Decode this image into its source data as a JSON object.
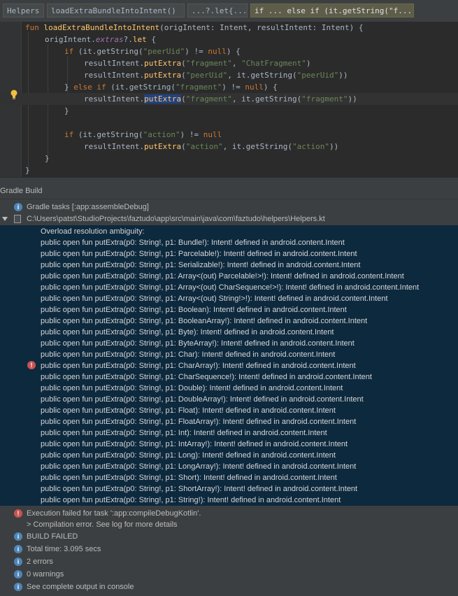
{
  "breadcrumbs": [
    "Helpers",
    "loadExtraBundleIntoIntent()",
    "...?.let{...}",
    "if ... else if (it.getString(\"f..."
  ],
  "code": {
    "l1": {
      "fun_kw": "fun ",
      "fn_name": "loadExtraBundleIntoIntent",
      "rest": "(origIntent: Intent, resultIntent: Intent) {"
    },
    "l2": {
      "a": "origIntent.",
      "extras": "extras",
      "b": "?.",
      "let": "let",
      "c": " {"
    },
    "l3": {
      "if": "if",
      "a": " (it.getString(",
      "s": "\"peerUid\"",
      "b": ") != ",
      "null": "null",
      "c": ") {"
    },
    "l4": {
      "a": "resultIntent.",
      "m": "putExtra",
      "b": "(",
      "s1": "\"fragment\"",
      "c": ", ",
      "s2": "\"ChatFragment\"",
      "d": ")"
    },
    "l5": {
      "a": "resultIntent.",
      "m": "putExtra",
      "b": "(",
      "s1": "\"peerUid\"",
      "c": ", it.getString(",
      "s2": "\"peerUid\"",
      "d": "))"
    },
    "l6": {
      "a": "} ",
      "else": "else",
      "sp": " ",
      "if": "if",
      "b": " (it.getString(",
      "s": "\"fragment\"",
      "c": ") != ",
      "null": "null",
      "d": ") {"
    },
    "l7": {
      "a": "resultIntent.",
      "m": "putExtra",
      "b": "(",
      "s1": "\"fragment\"",
      "c": ", it.getString(",
      "s2": "\"fragment\"",
      "d": "))"
    },
    "l8": "}",
    "l9": {
      "if": "if",
      "a": " (it.getString(",
      "s": "\"action\"",
      "b": ") != ",
      "null": "null"
    },
    "l10": {
      "a": "resultIntent.",
      "m": "putExtra",
      "b": "(",
      "s1": "\"action\"",
      "c": ", it.getString(",
      "s2": "\"action\"",
      "d": "))"
    },
    "l11": "}",
    "l12": "}"
  },
  "panel_title": "Gradle Build",
  "tree": {
    "gradle_tasks": "Gradle tasks [:app:assembleDebug]",
    "file_path": "C:\\Users\\patst\\StudioProjects\\faztudo\\app\\src\\main\\java\\com\\faztudo\\helpers\\Helpers.kt"
  },
  "error_lines": [
    "Overload resolution ambiguity:",
    "public open fun putExtra(p0: String!, p1: Bundle!): Intent! defined in android.content.Intent",
    "public open fun putExtra(p0: String!, p1: Parcelable!): Intent! defined in android.content.Intent",
    "public open fun putExtra(p0: String!, p1: Serializable!): Intent! defined in android.content.Intent",
    "public open fun putExtra(p0: String!, p1: Array<(out) Parcelable!>!): Intent! defined in android.content.Intent",
    "public open fun putExtra(p0: String!, p1: Array<(out) CharSequence!>!): Intent! defined in android.content.Intent",
    "public open fun putExtra(p0: String!, p1: Array<(out) String!>!): Intent! defined in android.content.Intent",
    "public open fun putExtra(p0: String!, p1: Boolean): Intent! defined in android.content.Intent",
    "public open fun putExtra(p0: String!, p1: BooleanArray!): Intent! defined in android.content.Intent",
    "public open fun putExtra(p0: String!, p1: Byte): Intent! defined in android.content.Intent",
    "public open fun putExtra(p0: String!, p1: ByteArray!): Intent! defined in android.content.Intent",
    "public open fun putExtra(p0: String!, p1: Char): Intent! defined in android.content.Intent",
    "public open fun putExtra(p0: String!, p1: CharArray!): Intent! defined in android.content.Intent",
    "public open fun putExtra(p0: String!, p1: CharSequence!): Intent! defined in android.content.Intent",
    "public open fun putExtra(p0: String!, p1: Double): Intent! defined in android.content.Intent",
    "public open fun putExtra(p0: String!, p1: DoubleArray!): Intent! defined in android.content.Intent",
    "public open fun putExtra(p0: String!, p1: Float): Intent! defined in android.content.Intent",
    "public open fun putExtra(p0: String!, p1: FloatArray!): Intent! defined in android.content.Intent",
    "public open fun putExtra(p0: String!, p1: Int): Intent! defined in android.content.Intent",
    "public open fun putExtra(p0: String!, p1: IntArray!): Intent! defined in android.content.Intent",
    "public open fun putExtra(p0: String!, p1: Long): Intent! defined in android.content.Intent",
    "public open fun putExtra(p0: String!, p1: LongArray!): Intent! defined in android.content.Intent",
    "public open fun putExtra(p0: String!, p1: Short): Intent! defined in android.content.Intent",
    "public open fun putExtra(p0: String!, p1: ShortArray!): Intent! defined in android.content.Intent",
    "public open fun putExtra(p0: String!, p1: String!): Intent! defined in android.content.Intent"
  ],
  "bottom": {
    "exec_failed": "Execution failed for task ':app:compileDebugKotlin'.",
    "compile_error": "> Compilation error. See log for more details",
    "build_failed": "BUILD FAILED",
    "total_time": "Total time: 3.095 secs",
    "errors": "2 errors",
    "warnings": "0 warnings",
    "see_output": "See complete output in console"
  },
  "icons": {
    "info": "info-icon",
    "error": "error-icon",
    "bulb": "lightbulb-icon",
    "file": "kotlin-file-icon",
    "expand": "chevron-down-icon"
  },
  "colors": {
    "keyword": "#cc7832",
    "function": "#ffc66d",
    "string": "#6a8759",
    "error_bg": "#0d293e",
    "error_icon": "#c75450",
    "info_icon": "#4e86b8"
  }
}
